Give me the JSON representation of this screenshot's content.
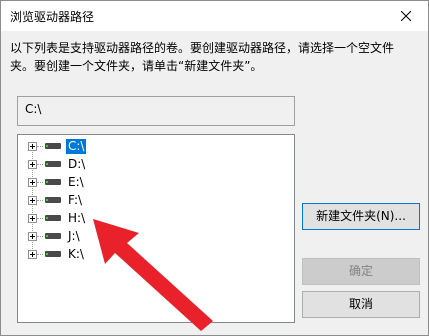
{
  "window": {
    "title": "浏览驱动器路径",
    "close_icon": "close-icon"
  },
  "instruction": {
    "line1": "以下列表是支持驱动器路径的卷。要创建驱动器路径，请选择一个空文件",
    "line2": "夹。要创建一个文件夹，请单击“新建文件夹”。"
  },
  "path": {
    "value": "C:\\"
  },
  "tree": {
    "items": [
      {
        "label": "C:\\",
        "selected": true
      },
      {
        "label": "D:\\",
        "selected": false
      },
      {
        "label": "E:\\",
        "selected": false
      },
      {
        "label": "F:\\",
        "selected": false
      },
      {
        "label": "H:\\",
        "selected": false
      },
      {
        "label": "J:\\",
        "selected": false
      },
      {
        "label": "K:\\",
        "selected": false
      }
    ]
  },
  "buttons": {
    "new_folder": "新建文件夹(N)...",
    "ok": "确定",
    "cancel": "取消"
  },
  "colors": {
    "selection": "#0078d7",
    "annotation_arrow": "#e8212b",
    "drive_led": "#2bd92b"
  }
}
